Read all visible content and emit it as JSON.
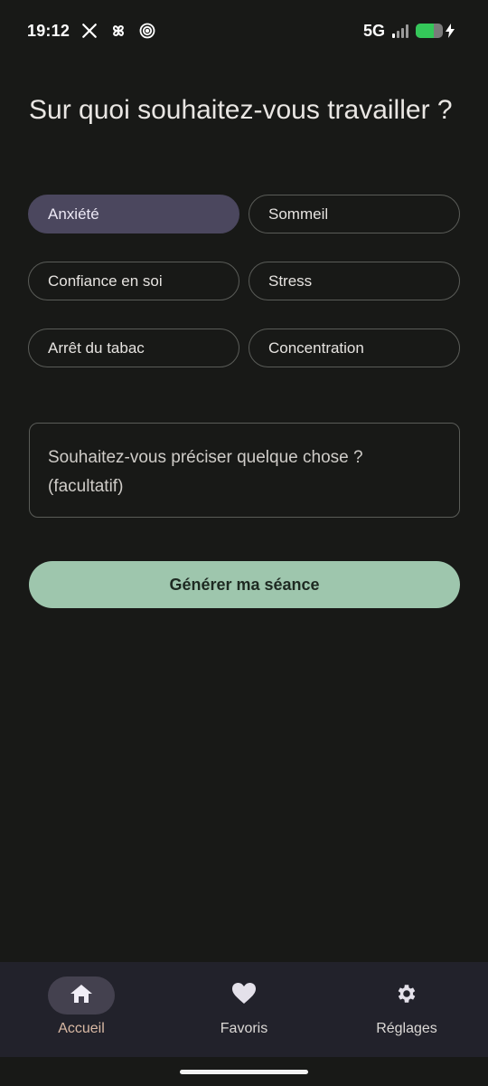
{
  "status_bar": {
    "time": "19:12",
    "network": "5G",
    "battery_level": 0.65,
    "notification_icons": [
      "x-logo-icon",
      "pinwheel-icon",
      "target-icon"
    ]
  },
  "page": {
    "title": "Sur quoi souhaitez-vous travailler ?"
  },
  "topics": [
    {
      "label": "Anxiété",
      "selected": true
    },
    {
      "label": "Sommeil",
      "selected": false
    },
    {
      "label": "Confiance en soi",
      "selected": false
    },
    {
      "label": "Stress",
      "selected": false
    },
    {
      "label": "Arrêt du tabac",
      "selected": false
    },
    {
      "label": "Concentration",
      "selected": false
    }
  ],
  "details_field": {
    "placeholder": "Souhaitez-vous préciser quelque chose ? (facultatif)",
    "value": ""
  },
  "generate_button": {
    "label": "Générer ma séance"
  },
  "bottom_nav": [
    {
      "label": "Accueil",
      "icon": "home-icon",
      "active": true
    },
    {
      "label": "Favoris",
      "icon": "heart-icon",
      "active": false
    },
    {
      "label": "Réglages",
      "icon": "gear-icon",
      "active": false
    }
  ],
  "colors": {
    "background": "#181917",
    "chip_selected": "#4b475e",
    "primary_button": "#9ec6ad",
    "nav_background": "#22222b",
    "active_nav_label": "#d9b9a4"
  }
}
